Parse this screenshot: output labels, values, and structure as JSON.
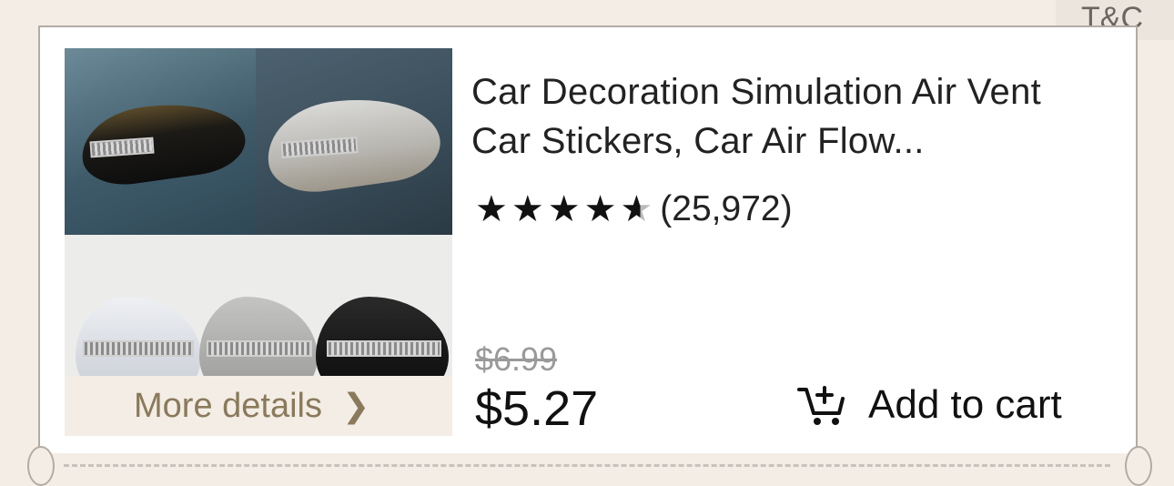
{
  "tc_label": "T&C",
  "product": {
    "title": "Car Decoration Simulation Air Vent Car Stickers, Car Air Flow...",
    "rating_count": "(25,972)",
    "stars": 4.5,
    "original_price": "$6.99",
    "price": "$5.27",
    "more_details_label": "More details",
    "add_to_cart_label": "Add to cart"
  },
  "icons": {
    "chevron": "chevron-right-icon",
    "cart": "cart-plus-icon",
    "star": "star-icon"
  }
}
